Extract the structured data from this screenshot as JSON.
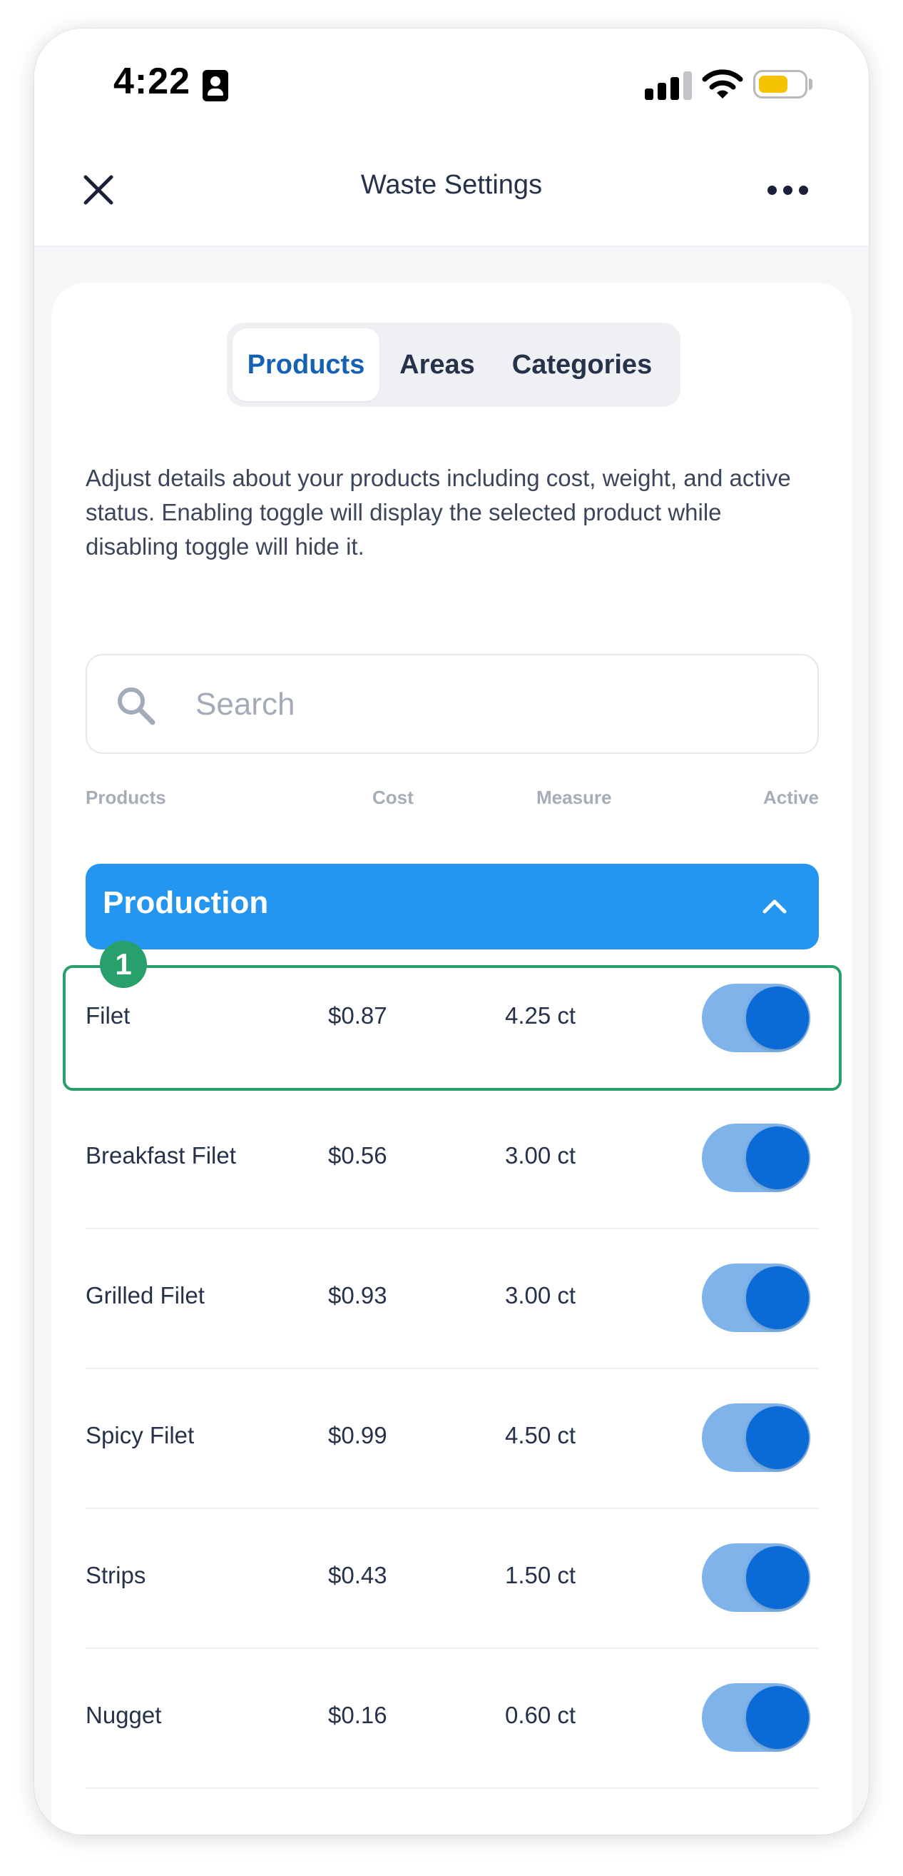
{
  "status_bar": {
    "time": "4:22"
  },
  "header": {
    "title": "Waste Settings"
  },
  "tabs": [
    {
      "label": "Products",
      "active": true
    },
    {
      "label": "Areas",
      "active": false
    },
    {
      "label": "Categories",
      "active": false
    }
  ],
  "description": "Adjust details about your products including cost, weight, and active status. Enabling toggle will display the selected product while disabling toggle will hide it.",
  "search": {
    "placeholder": "Search",
    "value": ""
  },
  "columns": {
    "product": "Products",
    "cost": "Cost",
    "measure": "Measure",
    "active": "Active"
  },
  "group": {
    "title": "Production",
    "expanded": true
  },
  "annotation": {
    "badge": "1"
  },
  "products": [
    {
      "name": "Filet",
      "cost": "$0.87",
      "measure": "4.25 ct",
      "active": true
    },
    {
      "name": "Breakfast Filet",
      "cost": "$0.56",
      "measure": "3.00 ct",
      "active": true
    },
    {
      "name": "Grilled Filet",
      "cost": "$0.93",
      "measure": "3.00 ct",
      "active": true
    },
    {
      "name": "Spicy Filet",
      "cost": "$0.99",
      "measure": "4.50 ct",
      "active": true
    },
    {
      "name": "Strips",
      "cost": "$0.43",
      "measure": "1.50 ct",
      "active": true
    },
    {
      "name": "Nugget",
      "cost": "$0.16",
      "measure": "0.60 ct",
      "active": true
    }
  ],
  "colors": {
    "primary_blue": "#2496f0",
    "tab_active_text": "#1562b4",
    "toggle_track": "#7fb3ea",
    "toggle_knob": "#0a6ad6",
    "highlight_green": "#27a06b"
  }
}
